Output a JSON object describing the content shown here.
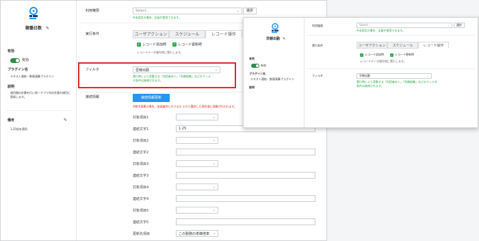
{
  "main": {
    "plugin_name": "稼働日数",
    "active_label": "有効",
    "plugin_type_label": "プラグイン名",
    "plugin_type": "テキスト連結・数値演算プラグイン",
    "desc_label": "説明",
    "desc": "項目間の計算を行い同一アプリ内の任意の項目に登録します。",
    "remarks_label": "備考",
    "remarks": "1.25倍を適用",
    "users_label": "利用権限",
    "users_placeholder": "Select...",
    "users_button": "選択",
    "users_note": "※未設定の場合、全員が使用できます。",
    "exec_label": "実行条件",
    "tabs": [
      "ユーザアクション",
      "スケジュール",
      "レコード操作"
    ],
    "check1": "レコード追加時",
    "check2": "レコード更新時",
    "exec_note": "レコードデータ操作時に実行します。",
    "filter_label": "フィルタ",
    "filter_value": "否稼出勤",
    "filter_note": "実行時により変動する「利用者本人」「所属組織」などのフィル\nタ条件は無視されます。",
    "connection_label": "接続情報",
    "connection_button": "接続情報更新",
    "connection_note": "※数字演算の場合、加減乗除とかける方 エから選択した項目値に演算が行われます。",
    "fields": [
      {
        "label": "対象項目1",
        "kind": "select",
        "value": ""
      },
      {
        "label": "連結文字1",
        "kind": "input",
        "value": "1.25"
      },
      {
        "label": "対象項目2",
        "kind": "select",
        "value": ""
      },
      {
        "label": "連結文字2",
        "kind": "input",
        "value": ""
      },
      {
        "label": "対象項目3",
        "kind": "select",
        "value": ""
      },
      {
        "label": "連結文字3",
        "kind": "input",
        "value": ""
      },
      {
        "label": "対象項目4",
        "kind": "select",
        "value": ""
      },
      {
        "label": "連結文字4",
        "kind": "input",
        "value": ""
      },
      {
        "label": "対象項目5",
        "kind": "select",
        "value": ""
      },
      {
        "label": "連結文字5",
        "kind": "input",
        "value": ""
      },
      {
        "label": "更新先項目",
        "kind": "select",
        "value": "この勤務の単価倍率"
      }
    ]
  },
  "overlay": {
    "plugin_name": "早朝出勤",
    "active_label": "有効",
    "plugin_type_label": "プラグイン名",
    "plugin_type": "テキスト連結・数値演算プラグイン",
    "desc_label": "説明",
    "users_label": "利用権限",
    "users_placeholder": "Select...",
    "users_button": "選択",
    "users_note": "※未設定の場合、全員が使用できます。",
    "exec_label": "実行条件",
    "tabs": [
      "ユーザアクション",
      "スケジュール",
      "レコード操作"
    ],
    "check1": "レコード追加時",
    "check2": "レコード更新時",
    "exec_note": "レコードデータ操作時に実行します。",
    "filter_label": "フィルタ",
    "filter_value": "早朝出勤",
    "filter_note": "実行時により変動する「利用者本人」「所属組織」などのフィルタ\n条件は無視されます。"
  },
  "colors": {
    "accent": "#2196f3",
    "green": "#27a844",
    "highlight": "#e02424",
    "toggle": "#2e8b4a"
  }
}
